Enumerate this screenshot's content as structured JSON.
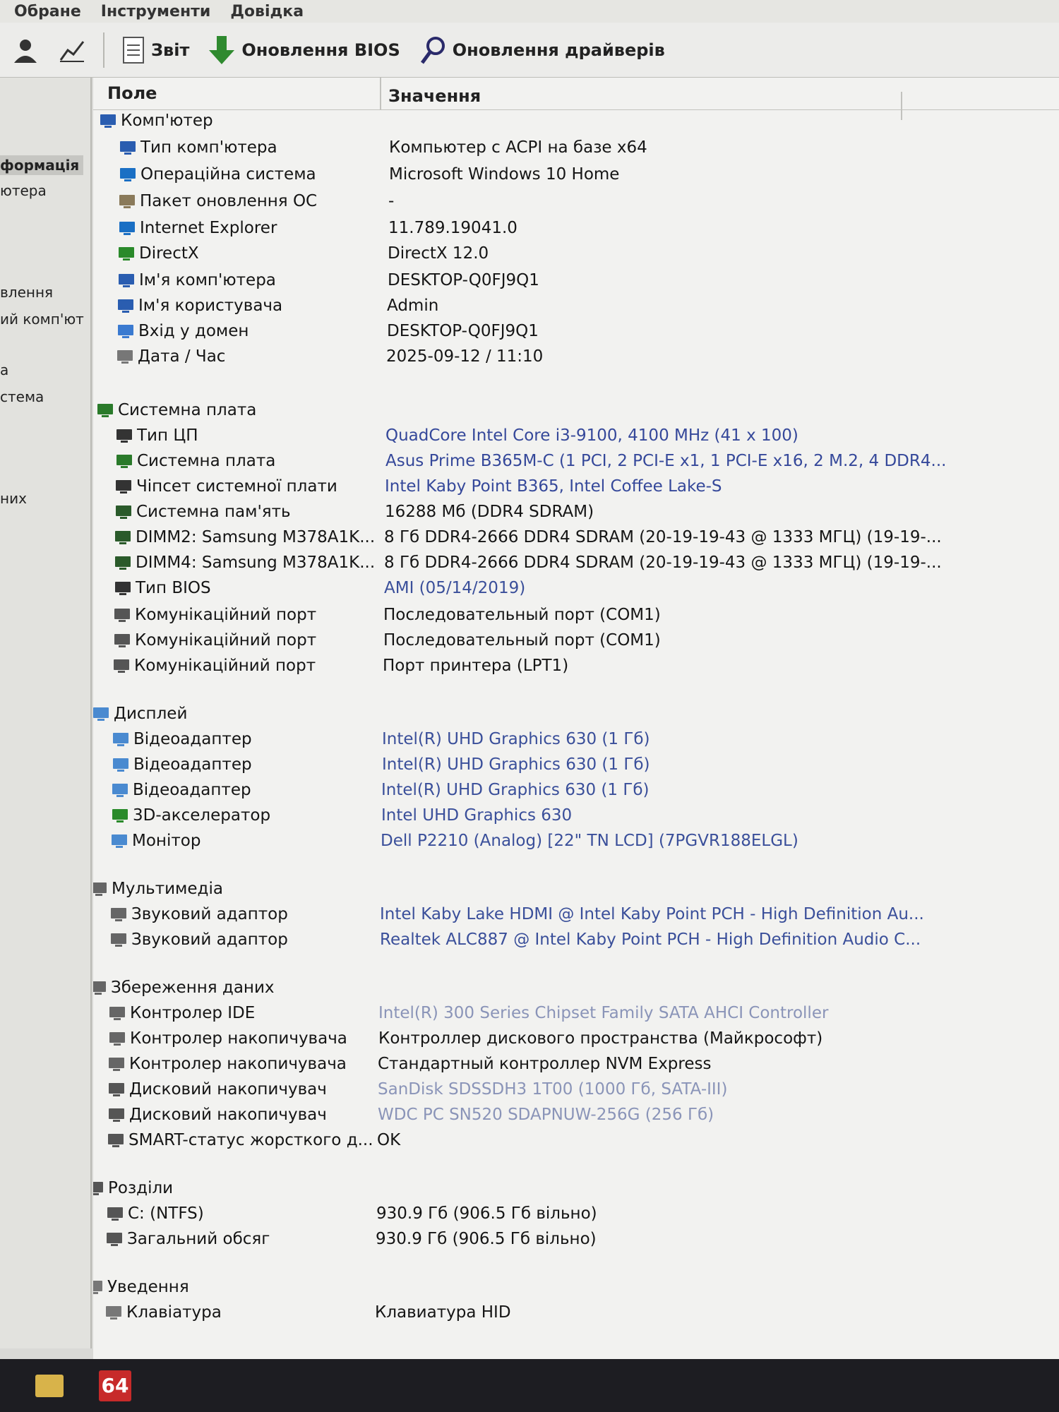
{
  "menu": {
    "items": [
      "Обране",
      "Інструменти",
      "Довідка"
    ]
  },
  "toolbar": {
    "report_label": "Звіт",
    "bios_label": "Оновлення BIOS",
    "drivers_label": "Оновлення драйверів"
  },
  "sidebar": {
    "items": [
      "формація",
      "ютера",
      "влення",
      "ий комп'ют",
      "а",
      "стема",
      "них"
    ]
  },
  "columns": {
    "field": "Поле",
    "value": "Значення"
  },
  "rows": [
    {
      "label": "Комп'ютер",
      "value": ""
    },
    {
      "label": "Тип комп'ютера",
      "value": "Компьютер с ACPI на базе x64"
    },
    {
      "label": "Операційна система",
      "value": "Microsoft Windows 10 Home"
    },
    {
      "label": "Пакет оновлення ОС",
      "value": "-"
    },
    {
      "label": "Internet Explorer",
      "value": "11.789.19041.0"
    },
    {
      "label": "DirectX",
      "value": "DirectX 12.0"
    },
    {
      "label": "Ім'я комп'ютера",
      "value": "DESKTOP-Q0FJ9Q1"
    },
    {
      "label": "Ім'я користувача",
      "value": "Admin"
    },
    {
      "label": "Вхід у домен",
      "value": "DESKTOP-Q0FJ9Q1"
    },
    {
      "label": "Дата / Час",
      "value": "2025-09-12 / 11:10"
    },
    {
      "label": "Системна плата",
      "value": ""
    },
    {
      "label": "Тип ЦП",
      "value": "QuadCore Intel Core i3-9100, 4100 MHz (41 x 100)"
    },
    {
      "label": "Системна плата",
      "value": "Asus Prime B365M-C  (1 PCI, 2 PCI-E x1, 1 PCI-E x16, 2 M.2, 4 DDR4..."
    },
    {
      "label": "Чіпсет системної плати",
      "value": "Intel Kaby Point B365, Intel Coffee Lake-S"
    },
    {
      "label": "Системна пам'ять",
      "value": "16288 Мб  (DDR4 SDRAM)"
    },
    {
      "label": "DIMM2: Samsung M378A1K...",
      "value": "8 Гб DDR4-2666 DDR4 SDRAM  (20-19-19-43 @ 1333 МГЦ)  (19-19-..."
    },
    {
      "label": "DIMM4: Samsung M378A1K...",
      "value": "8 Гб DDR4-2666 DDR4 SDRAM  (20-19-19-43 @ 1333 МГЦ)  (19-19-..."
    },
    {
      "label": "Тип BIOS",
      "value": "AMI (05/14/2019)"
    },
    {
      "label": "Комунікаційний порт",
      "value": "Последовательный порт (COM1)"
    },
    {
      "label": "Комунікаційний порт",
      "value": "Последовательный порт (COM1)"
    },
    {
      "label": "Комунікаційний порт",
      "value": "Порт принтера (LPT1)"
    },
    {
      "label": "Дисплей",
      "value": ""
    },
    {
      "label": "Відеоадаптер",
      "value": "Intel(R) UHD Graphics 630  (1 Гб)"
    },
    {
      "label": "Відеоадаптер",
      "value": "Intel(R) UHD Graphics 630  (1 Гб)"
    },
    {
      "label": "Відеоадаптер",
      "value": "Intel(R) UHD Graphics 630  (1 Гб)"
    },
    {
      "label": "3D-акселератор",
      "value": "Intel UHD Graphics 630"
    },
    {
      "label": "Монітор",
      "value": "Dell P2210 (Analog)  [22\" TN LCD]  (7PGVR188ELGL)"
    },
    {
      "label": "Мультимедіа",
      "value": ""
    },
    {
      "label": "Звуковий адаптор",
      "value": "Intel Kaby Lake HDMI @ Intel Kaby Point PCH - High Definition Au..."
    },
    {
      "label": "Звуковий адаптор",
      "value": "Realtek ALC887 @ Intel Kaby Point PCH - High Definition Audio C..."
    },
    {
      "label": "Збереження даних",
      "value": ""
    },
    {
      "label": "Контролер IDE",
      "value": "Intel(R) 300 Series Chipset Family SATA AHCI Controller"
    },
    {
      "label": "Контролер накопичувача",
      "value": "Контроллер дискового пространства (Майкрософт)"
    },
    {
      "label": "Контролер накопичувача",
      "value": "Стандартный контроллер NVM Express"
    },
    {
      "label": "Дисковий накопичувач",
      "value": "SanDisk SDSSDH3 1T00  (1000 Гб, SATA-III)"
    },
    {
      "label": "Дисковий накопичувач",
      "value": "WDC PC SN520 SDAPNUW-256G  (256 Гб)"
    },
    {
      "label": "SMART-статус жорсткого д...",
      "value": "OK"
    },
    {
      "label": "Розділи",
      "value": ""
    },
    {
      "label": "C: (NTFS)",
      "value": "930.9 Гб (906.5 Гб вільно)"
    },
    {
      "label": "Загальний обсяг",
      "value": "930.9 Гб (906.5 Гб вільно)"
    },
    {
      "label": "Уведення",
      "value": ""
    },
    {
      "label": "Клавіатура",
      "value": "Клавиатура HID"
    }
  ],
  "taskbar": {
    "app_badge": "64"
  }
}
